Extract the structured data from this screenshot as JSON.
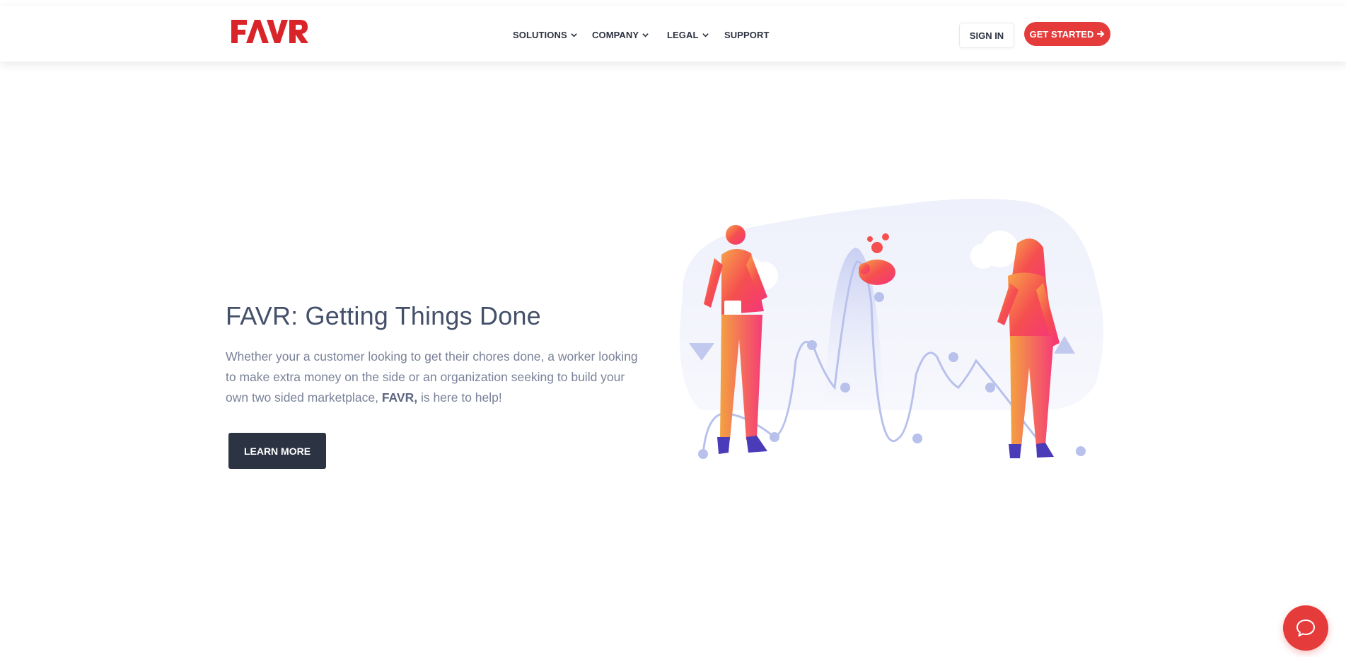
{
  "brand": {
    "name": "FAVR",
    "color": "#d9242a"
  },
  "nav": {
    "items": [
      {
        "label": "SOLUTIONS",
        "dropdown": true
      },
      {
        "label": "COMPANY",
        "dropdown": true
      },
      {
        "label": "LEGAL",
        "dropdown": true
      },
      {
        "label": "SUPPORT",
        "dropdown": false
      }
    ],
    "sign_in": "SIGN IN",
    "get_started": "GET STARTED",
    "get_started_icon": "arrow-right-icon"
  },
  "hero": {
    "title": "FAVR: Getting Things Done",
    "text_before": "Whether your a customer looking to get their chores done, a worker looking to make extra money on the side or an organization seeking to build your own two sided marketplace,",
    "text_bold": "FAVR,",
    "text_after": "is here to help!",
    "cta": "LEARN MORE"
  },
  "chat": {
    "icon": "chat-bubble-icon"
  },
  "colors": {
    "accent": "#e53b3b",
    "dark_button": "#2c3444",
    "heading": "#44506a",
    "body_text": "#7a8298"
  }
}
